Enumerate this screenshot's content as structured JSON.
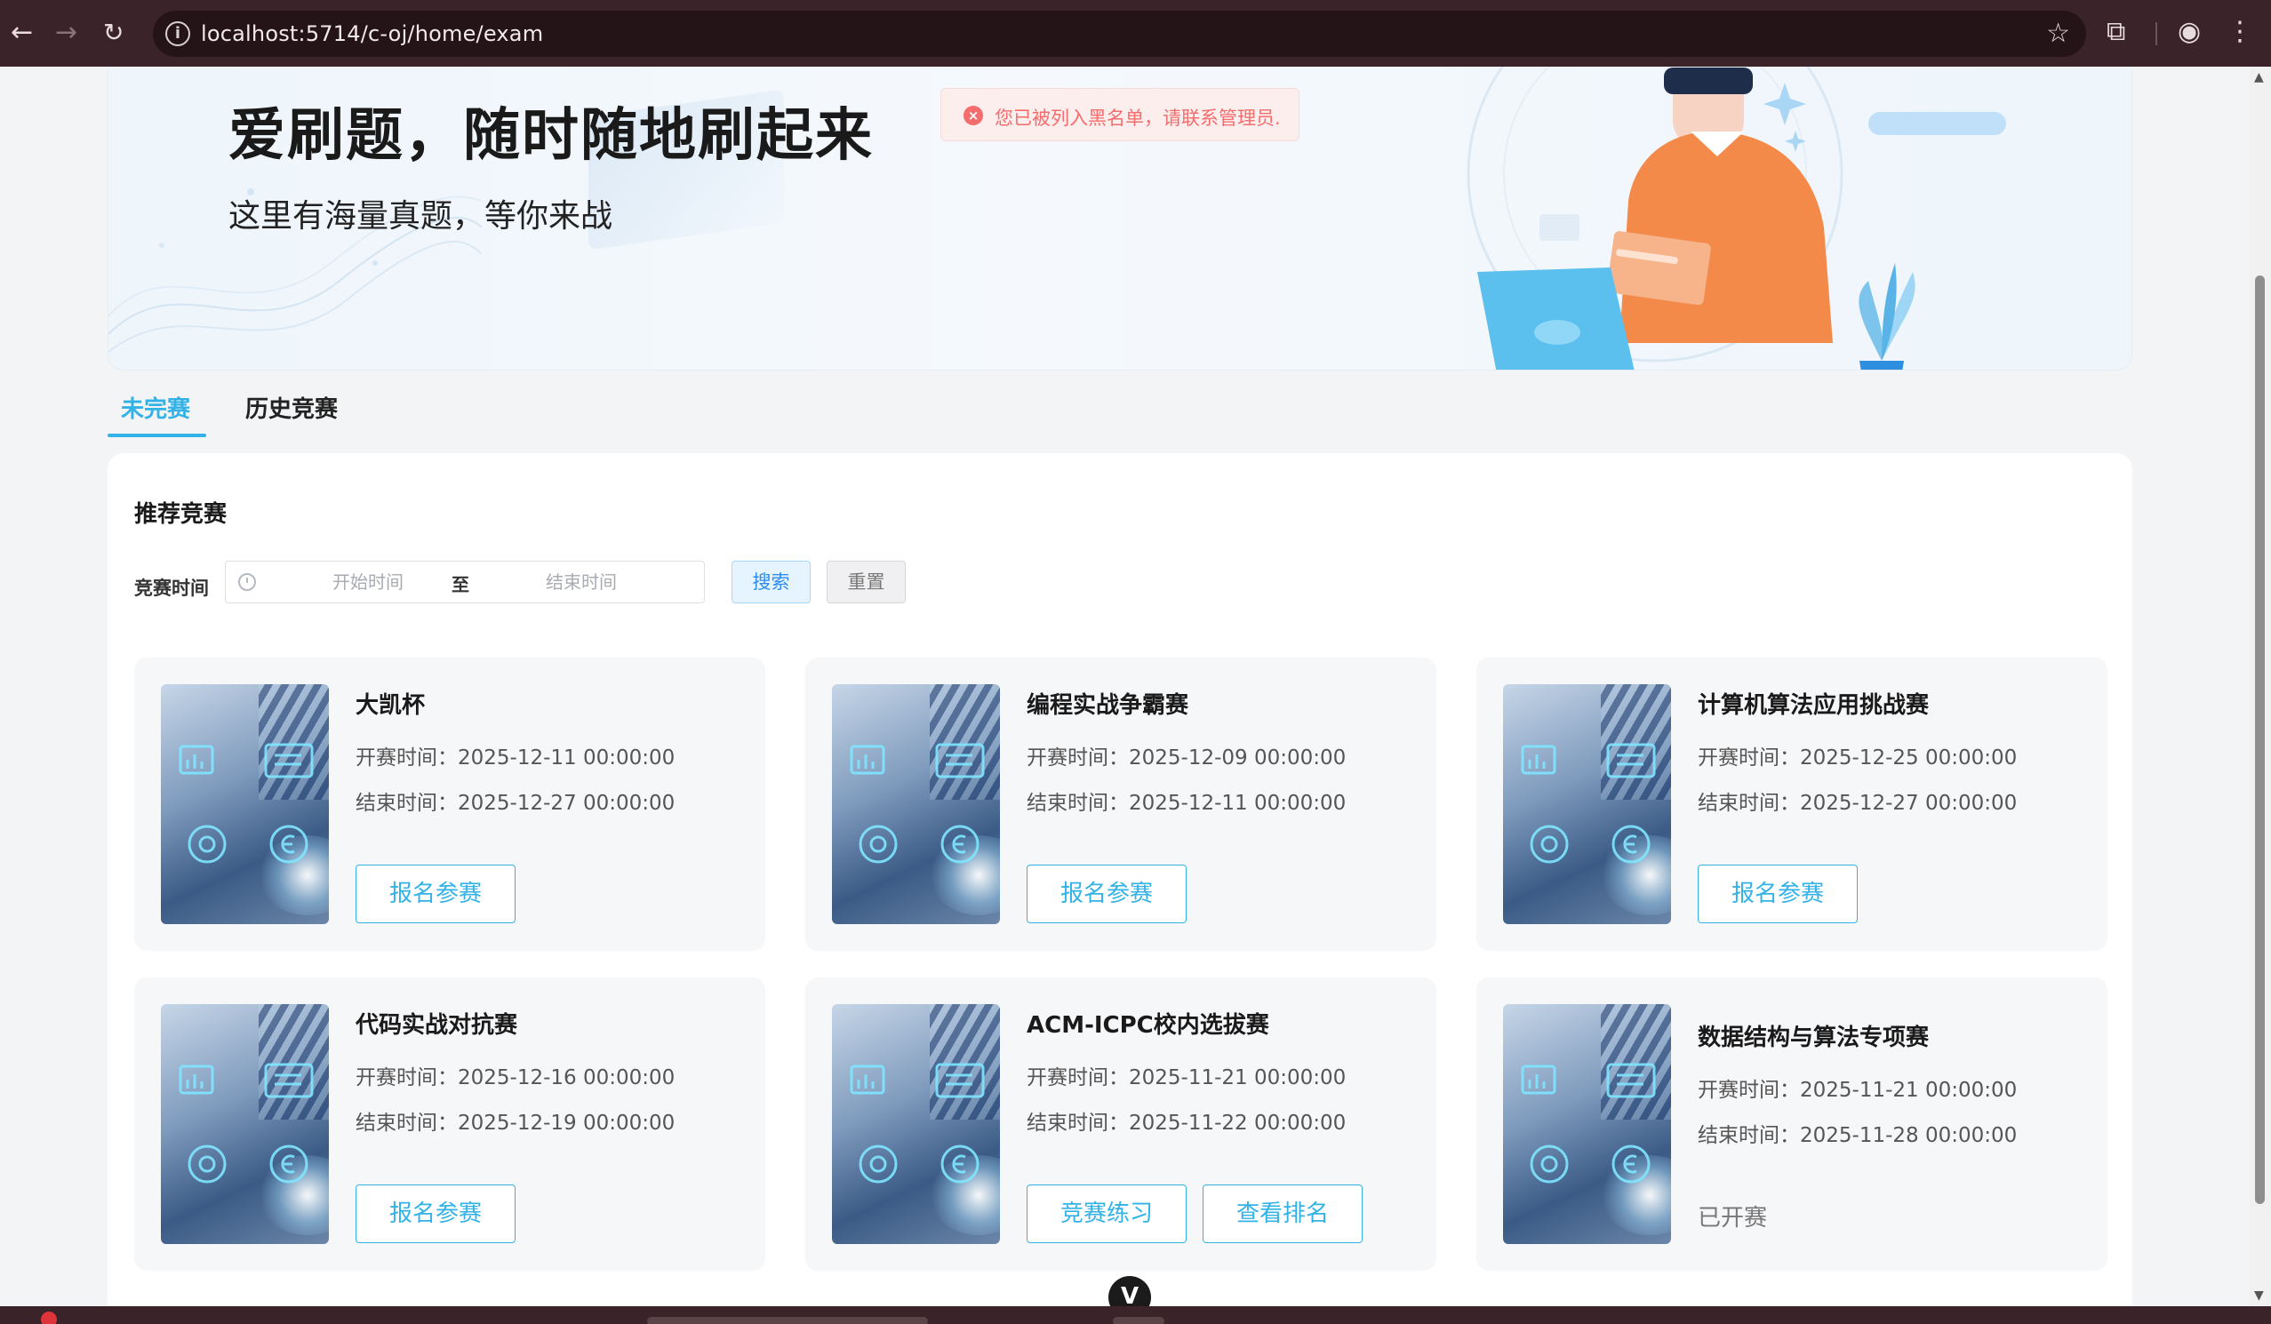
{
  "browser": {
    "url": "localhost:5714/c-oj/home/exam",
    "info_glyph": "i"
  },
  "banner": {
    "title": "爱刷题，随时随地刷起来",
    "subtitle": "这里有海量真题，等你来战"
  },
  "toast": {
    "message": "您已被列入黑名单，请联系管理员.",
    "icon": "error-circle-icon",
    "icon_glyph": "×",
    "color": "#f56c6c"
  },
  "tabs": [
    {
      "label": "未完赛",
      "active": true
    },
    {
      "label": "历史竞赛",
      "active": false
    }
  ],
  "section": {
    "title": "推荐竞赛",
    "filter_label": "竞赛时间",
    "start_placeholder": "开始时间",
    "end_placeholder": "结束时间",
    "range_separator": "至",
    "search_label": "搜索",
    "reset_label": "重置"
  },
  "cards": [
    {
      "title": "大凯杯",
      "start_label": "开赛时间：",
      "start": "2025-12-11 00:00:00",
      "end_label": "结束时间：",
      "end": "2025-12-27 00:00:00",
      "buttons": [
        "报名参赛"
      ]
    },
    {
      "title": "编程实战争霸赛",
      "start_label": "开赛时间：",
      "start": "2025-12-09 00:00:00",
      "end_label": "结束时间：",
      "end": "2025-12-11 00:00:00",
      "buttons": [
        "报名参赛"
      ]
    },
    {
      "title": "计算机算法应用挑战赛",
      "start_label": "开赛时间：",
      "start": "2025-12-25 00:00:00",
      "end_label": "结束时间：",
      "end": "2025-12-27 00:00:00",
      "buttons": [
        "报名参赛"
      ]
    },
    {
      "title": "代码实战对抗赛",
      "start_label": "开赛时间：",
      "start": "2025-12-16 00:00:00",
      "end_label": "结束时间：",
      "end": "2025-12-19 00:00:00",
      "buttons": [
        "报名参赛"
      ]
    },
    {
      "title": "ACM-ICPC校内选拔赛",
      "start_label": "开赛时间：",
      "start": "2025-11-21 00:00:00",
      "end_label": "结束时间：",
      "end": "2025-11-22 00:00:00",
      "buttons": [
        "竞赛练习",
        "查看排名"
      ]
    },
    {
      "title": "数据结构与算法专项赛",
      "start_label": "开赛时间：",
      "start": "2025-11-21 00:00:00",
      "end_label": "结束时间：",
      "end": "2025-11-28 00:00:00",
      "status": "已开赛"
    }
  ],
  "scroll_hint": {
    "glyph": "V"
  },
  "colors": {
    "accent": "#32b2e6",
    "chrome": "#3b2429",
    "error": "#f56c6c"
  }
}
